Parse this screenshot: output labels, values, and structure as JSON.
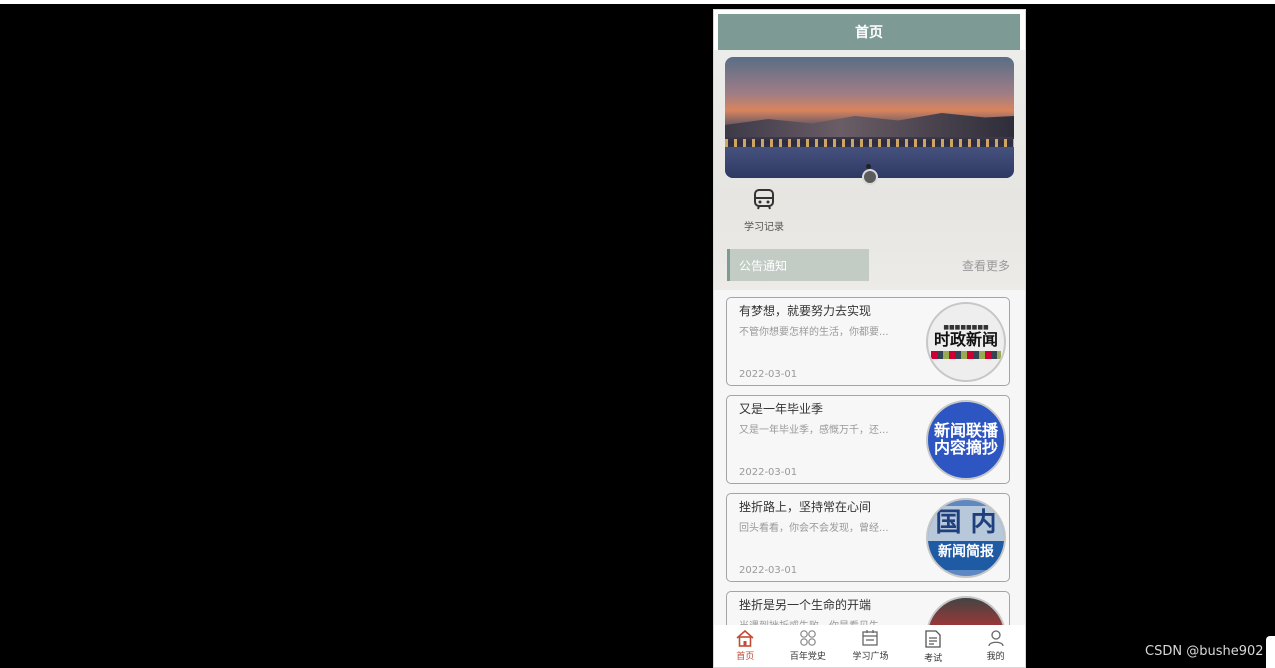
{
  "page_title": "首页",
  "quick_entry": {
    "label": "学习记录",
    "icon": "bus-icon"
  },
  "notice_section": {
    "title": "公告通知",
    "more_label": "查看更多"
  },
  "news": [
    {
      "title": "有梦想，就要努力去实现",
      "summary": "不管你想要怎样的生活，你都要...",
      "date": "2022-03-01",
      "thumb_text": "时政新闻"
    },
    {
      "title": "又是一年毕业季",
      "summary": "又是一年毕业季，感慨万千，还...",
      "date": "2022-03-01",
      "thumb_text_1": "新闻联播",
      "thumb_text_2": "内容摘抄"
    },
    {
      "title": "挫折路上，坚持常在心间",
      "summary": "回头看看，你会不会发现，曾经...",
      "date": "2022-03-01",
      "thumb_text_1": "国 内",
      "thumb_text_2": "新闻简报"
    },
    {
      "title": "挫折是另一个生命的开端",
      "summary": "当遇到挫折或失败，你是看见失...",
      "date": ""
    }
  ],
  "tabbar": [
    {
      "label": "首页",
      "icon": "home-icon",
      "active": true
    },
    {
      "label": "百年党史",
      "icon": "grid-icon"
    },
    {
      "label": "学习广场",
      "icon": "calendar-icon"
    },
    {
      "label": "考试",
      "icon": "document-icon"
    },
    {
      "label": "我的",
      "icon": "user-icon"
    }
  ],
  "watermark": "CSDN @bushe902",
  "colors": {
    "header": "#7d9a94",
    "active_tab": "#c24b38",
    "background": "#000000"
  }
}
